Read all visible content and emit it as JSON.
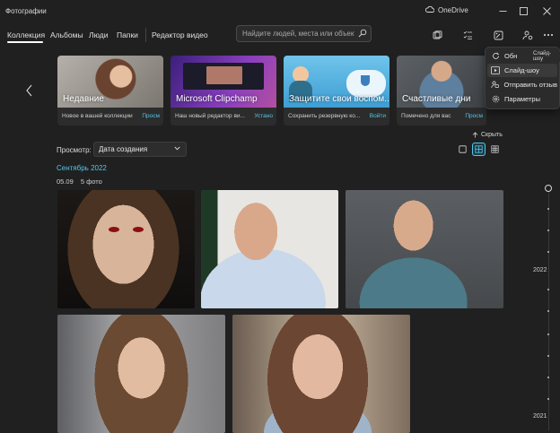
{
  "app": {
    "title": "Фотографии",
    "onedrive_label": "OneDrive"
  },
  "nav": {
    "tabs": [
      "Коллекция",
      "Альбомы",
      "Люди",
      "Папки",
      "Редактор видео"
    ],
    "active": "Коллекция"
  },
  "search": {
    "placeholder": "Найдите людей, места или объекты."
  },
  "cards": [
    {
      "title": "Недавние",
      "desc": "Новое в вашей коллекции",
      "link": "Просм"
    },
    {
      "title": "Microsoft Clipchamp",
      "desc": "Наш новый редактор ви...",
      "link": "Устано"
    },
    {
      "title": "Защитите свои воспом...",
      "desc": "Сохранить резервную ко...",
      "link": "Войти"
    },
    {
      "title": "Счастливые дни",
      "desc": "Помечено для вас",
      "link": "Просм"
    }
  ],
  "menu": {
    "tooltip": "Слайд-шоу",
    "items": [
      {
        "label": "Обн",
        "icon": "refresh-icon"
      },
      {
        "label": "Слайд-шоу",
        "icon": "slideshow-icon"
      },
      {
        "label": "Отправить отзыв",
        "icon": "feedback-icon"
      },
      {
        "label": "Параметры",
        "icon": "settings-icon"
      }
    ]
  },
  "view": {
    "label": "Просмотр:",
    "selected": "Дата создания",
    "hide_label": "Скрыть"
  },
  "gallery": {
    "month": "Сентябрь 2022",
    "date": "05.09",
    "count": "5 фото"
  },
  "timeline": {
    "years": [
      "2022",
      "2021"
    ]
  },
  "colors": {
    "accent": "#52c8ec",
    "background": "#202020",
    "card": "#2c2c2c"
  }
}
